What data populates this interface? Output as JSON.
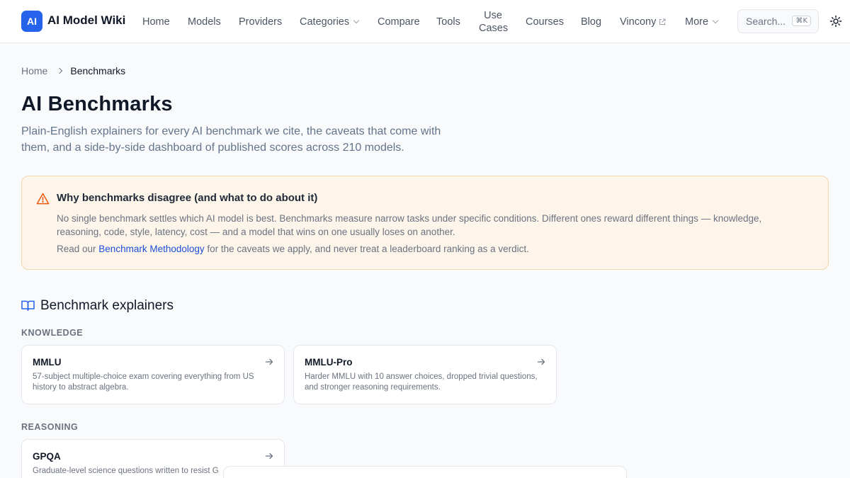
{
  "header": {
    "logo_badge": "AI",
    "logo_text": "AI Model Wiki",
    "nav": [
      {
        "label": "Home"
      },
      {
        "label": "Models"
      },
      {
        "label": "Providers"
      },
      {
        "label": "Categories"
      },
      {
        "label": "Compare"
      },
      {
        "label": "Tools"
      },
      {
        "label": "Use Cases"
      },
      {
        "label": "Courses"
      },
      {
        "label": "Blog"
      },
      {
        "label": "Vincony"
      },
      {
        "label": "More"
      }
    ],
    "search": {
      "placeholder": "Search...",
      "shortcut": "⌘K"
    },
    "icons": {
      "theme": "sun-icon",
      "external": "external-link-icon"
    }
  },
  "breadcrumb": {
    "home": "Home",
    "current": "Benchmarks"
  },
  "page": {
    "title": "AI Benchmarks",
    "intro": "Plain-English explainers for every AI benchmark we cite, the caveats that come with them, and a side-by-side dashboard of published scores across 210 models."
  },
  "callout": {
    "icon": "warning-triangle-icon",
    "title": "Why benchmarks disagree (and what to do about it)",
    "body": "No single benchmark settles which AI model is best. Benchmarks measure narrow tasks under specific conditions. Different ones reward different things — knowledge, reasoning, code, style, latency, cost — and a model that wins on one usually loses on another.",
    "read_prefix": "Read our ",
    "link": "Benchmark Methodology",
    "read_suffix": " for the caveats we apply, and never treat a leaderboard ranking as a verdict."
  },
  "explainers": {
    "icon": "open-book-icon",
    "title": "Benchmark explainers",
    "categories": [
      {
        "label": "KNOWLEDGE",
        "cards": [
          {
            "title": "MMLU",
            "desc": "57-subject multiple-choice exam covering everything from US history to abstract algebra."
          },
          {
            "title": "MMLU-Pro",
            "desc": "Harder MMLU with 10 answer choices, dropped trivial questions, and stronger reasoning requirements."
          }
        ]
      },
      {
        "label": "REASONING",
        "cards": [
          {
            "title": "GPQA",
            "desc": "Graduate-level science questions written to resist G"
          }
        ]
      }
    ]
  },
  "colors": {
    "accent": "#2563eb",
    "callout_bg": "#fdf5ea",
    "callout_border": "#f3d9b1",
    "warning": "#ea580c"
  }
}
